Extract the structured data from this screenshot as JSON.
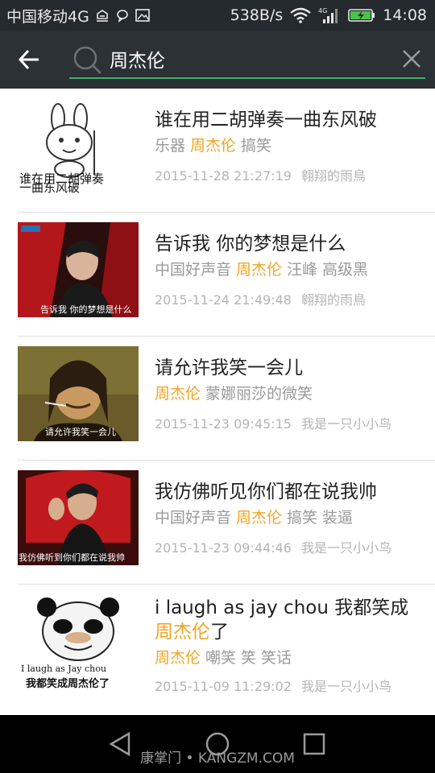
{
  "status_bar": {
    "carrier": "中国移动4G",
    "net_speed": "538B/s",
    "time": "14:08",
    "signal_tag": "4G"
  },
  "search": {
    "query": "周杰伦",
    "placeholder": ""
  },
  "results": [
    {
      "title": "谁在用二胡弹奏一曲东风破",
      "tags": [
        "乐器",
        "周杰伦",
        "搞笑"
      ],
      "timestamp": "2015-11-28 21:27:19",
      "author": "翱翔的雨鳥",
      "thumb_caption": [
        "谁在用二胡弹奏",
        "一曲东风破"
      ]
    },
    {
      "title": "告诉我 你的梦想是什么",
      "tags": [
        "中国好声音",
        "周杰伦",
        "汪峰",
        "高级黑"
      ],
      "timestamp": "2015-11-24 21:49:48",
      "author": "翱翔的雨鳥",
      "thumb_caption": [
        "告诉我  你的梦想是什么"
      ]
    },
    {
      "title": "请允许我笑一会儿",
      "tags": [
        "周杰伦",
        "蒙娜丽莎的微笑"
      ],
      "timestamp": "2015-11-23 09:45:15",
      "author": "我是一只小小鸟",
      "thumb_caption": [
        "请允许我笑一会儿"
      ]
    },
    {
      "title": "我仿佛听见你们都在说我帅",
      "tags": [
        "中国好声音",
        "周杰伦",
        "搞笑",
        "装逼"
      ],
      "timestamp": "2015-11-23 09:44:46",
      "author": "我是一只小小鸟",
      "thumb_caption": [
        "我仿佛听到你们都在说我帅"
      ]
    },
    {
      "title_part1": "i laugh as jay chou 我都笑成",
      "title_hl": "周杰伦",
      "title_part2": "了",
      "tags": [
        "周杰伦",
        "嘲笑",
        "笑",
        "笑话"
      ],
      "timestamp": "2015-11-09 11:29:02",
      "author": "我是一只小小鸟",
      "thumb_caption": [
        "I laugh as Jay chou",
        "我都笑成周杰伦了"
      ]
    }
  ],
  "nav": {
    "watermark": "康掌门 • KANGZM.COM"
  },
  "colors": {
    "accent": "#3fb06a",
    "highlight": "#f0a623",
    "appbar": "#2c3135",
    "statusbar": "#252a2e"
  },
  "icons": {
    "back": "arrow-left-icon",
    "search": "search-icon",
    "clear": "close-icon",
    "nav_back": "triangle-back-icon",
    "nav_home": "circle-home-icon",
    "nav_recent": "square-recent-icon"
  }
}
